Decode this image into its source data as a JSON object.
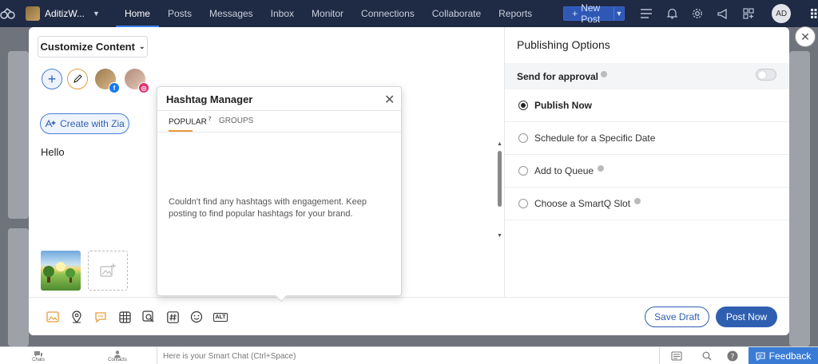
{
  "topnav": {
    "account_name": "AditizW...",
    "items": [
      "Home",
      "Posts",
      "Messages",
      "Inbox",
      "Monitor",
      "Connections",
      "Collaborate",
      "Reports"
    ],
    "new_post_label": "New Post",
    "avatar_initials": "AD"
  },
  "composer": {
    "customize_label": "Customize Content",
    "zia_label": "Create with Zia",
    "post_text": "Hello"
  },
  "hashtag_manager": {
    "title": "Hashtag Manager",
    "tab_popular": "POPULAR",
    "tab_popular_count": "7",
    "tab_groups": "GROUPS",
    "empty_message": "Couldn't find any hashtags with engagement. Keep posting to find popular hashtags for your brand."
  },
  "publishing": {
    "title": "Publishing Options",
    "approval_label": "Send for approval",
    "options": [
      {
        "label": "Publish Now",
        "selected": true,
        "help": false
      },
      {
        "label": "Schedule for a Specific Date",
        "selected": false,
        "help": false
      },
      {
        "label": "Add to Queue",
        "selected": false,
        "help": true
      },
      {
        "label": "Choose a SmartQ Slot",
        "selected": false,
        "help": true
      }
    ]
  },
  "actions": {
    "save_draft": "Save Draft",
    "post_now": "Post Now"
  },
  "toolbar": {
    "alt_label": "ALT"
  },
  "bottom": {
    "chats": "Chats",
    "contacts": "Contacts",
    "smart_chat_placeholder": "Here is your Smart Chat (Ctrl+Space)",
    "feedback": "Feedback"
  },
  "colors": {
    "nav_bg": "#1f2a44",
    "accent_blue": "#2f5fb0",
    "accent_orange": "#e89a3c",
    "facebook": "#1877f2",
    "instagram": "#e1306c"
  }
}
